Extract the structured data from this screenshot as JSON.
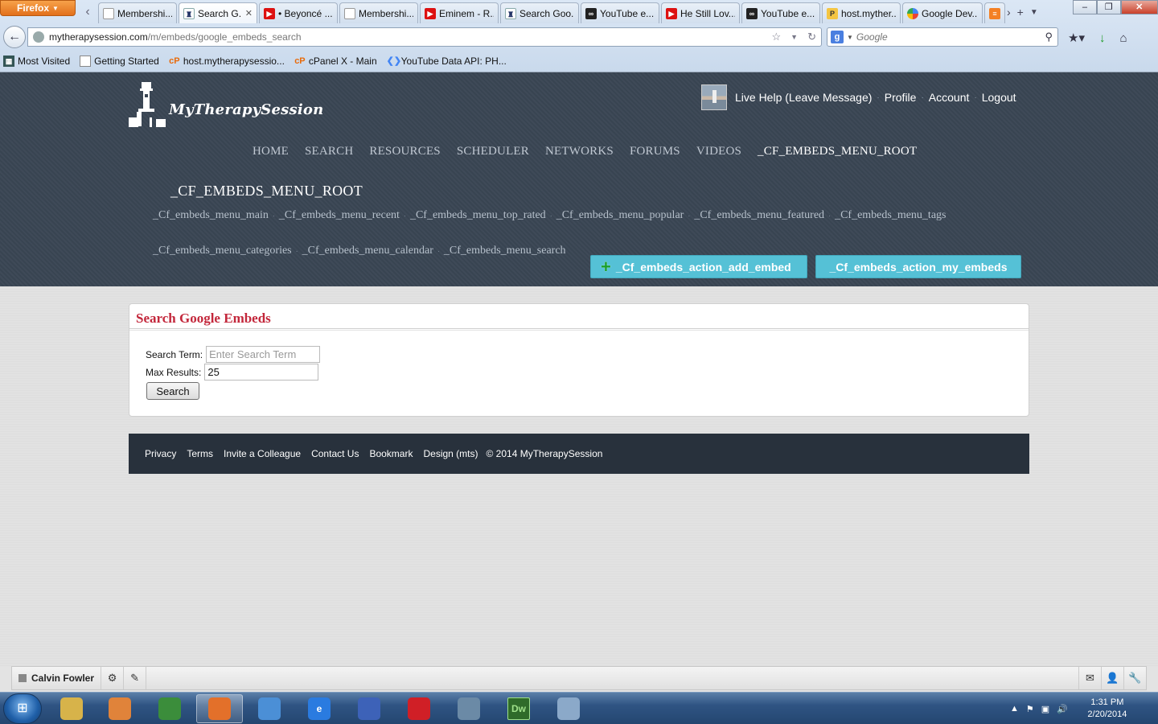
{
  "browser": {
    "app_button": "Firefox",
    "tabs": [
      {
        "label": "Membershi...",
        "icon": "blank-page-icon"
      },
      {
        "label": "Search G...",
        "icon": "mts-icon",
        "active": true
      },
      {
        "label": "• Beyoncé ...",
        "icon": "youtube-icon"
      },
      {
        "label": "Membershi...",
        "icon": "blank-page-icon"
      },
      {
        "label": "Eminem - R...",
        "icon": "youtube-icon"
      },
      {
        "label": "Search Goo...",
        "icon": "mts-icon"
      },
      {
        "label": "YouTube e...",
        "icon": "oo-icon"
      },
      {
        "label": "He Still Lov...",
        "icon": "youtube-icon"
      },
      {
        "label": "YouTube e...",
        "icon": "oo-icon"
      },
      {
        "label": "host.myther...",
        "icon": "phpmyadmin-icon"
      },
      {
        "label": "Google Dev...",
        "icon": "google-developers-icon"
      }
    ],
    "url_host": "mytherapysession.com",
    "url_path": "/m/embeds/google_embeds_search",
    "search_engine_placeholder": "Google",
    "bookmarks": [
      {
        "label": "Most Visited",
        "icon": "folder-icon"
      },
      {
        "label": "Getting Started",
        "icon": "page-icon"
      },
      {
        "label": "host.mytherapysessio...",
        "icon": "cpanel-icon"
      },
      {
        "label": "cPanel X - Main",
        "icon": "cpanel-icon"
      },
      {
        "label": "YouTube Data API: PH...",
        "icon": "google-developers-icon"
      }
    ]
  },
  "site": {
    "logo_text": "MyTherapySession",
    "userbar": [
      "Live Help (Leave Message)",
      "Profile",
      "Account",
      "Logout"
    ],
    "nav": [
      "HOME",
      "SEARCH",
      "RESOURCES",
      "SCHEDULER",
      "NETWORKS",
      "FORUMS",
      "VIDEOS",
      "_CF_EMBEDS_MENU_ROOT"
    ],
    "nav_active_index": 7,
    "section_title": "_CF_EMBEDS_MENU_ROOT",
    "submenu": [
      "_Cf_embeds_menu_main",
      "_Cf_embeds_menu_recent",
      "_Cf_embeds_menu_top_rated",
      "_Cf_embeds_menu_popular",
      "_Cf_embeds_menu_featured",
      "_Cf_embeds_menu_tags",
      "_Cf_embeds_menu_categories",
      "_Cf_embeds_menu_calendar",
      "_Cf_embeds_menu_search"
    ],
    "actions": {
      "add_embed": "_Cf_embeds_action_add_embed",
      "my_embeds": "_Cf_embeds_action_my_embeds"
    }
  },
  "search_panel": {
    "title": "Search Google Embeds",
    "term_label": "Search Term:",
    "term_placeholder": "Enter Search Term",
    "term_value": "",
    "max_label": "Max Results:",
    "max_value": "25",
    "button_label": "Search"
  },
  "footer": {
    "links": [
      "Privacy",
      "Terms",
      "Invite a Colleague",
      "Contact Us",
      "Bookmark",
      "Design (mts)"
    ],
    "copyright": "© 2014 MyTherapySession"
  },
  "chatbar": {
    "user_name": "Calvin Fowler"
  },
  "taskbar": {
    "apps": [
      {
        "name": "file-explorer-icon",
        "label": "",
        "color": "#d7b34a"
      },
      {
        "name": "media-player-icon",
        "label": "",
        "color": "#e0833a"
      },
      {
        "name": "chrome-icon",
        "label": "",
        "color": "#3b8d3b"
      },
      {
        "name": "firefox-icon",
        "label": "",
        "color": "#e3702a",
        "active": true
      },
      {
        "name": "safari-icon",
        "label": "",
        "color": "#4b8fd6"
      },
      {
        "name": "internet-explorer-icon",
        "label": "e",
        "color": "#2a7be0"
      },
      {
        "name": "network-app-icon",
        "label": "",
        "color": "#3d62b8"
      },
      {
        "name": "creative-cloud-icon",
        "label": "",
        "color": "#d01f26"
      },
      {
        "name": "remote-app-icon",
        "label": "",
        "color": "#6b8aa6"
      },
      {
        "name": "dreamweaver-icon",
        "label": "Dw",
        "color": "#2f6b2a"
      },
      {
        "name": "paint-icon",
        "label": "",
        "color": "#8ba9c9"
      }
    ],
    "time": "1:31 PM",
    "date": "2/20/2014"
  }
}
